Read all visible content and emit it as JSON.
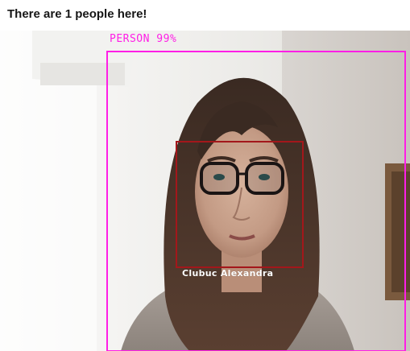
{
  "page": {
    "heading": "There are 1 people here!"
  },
  "detection": {
    "person_label": "PERSON 99%",
    "person_confidence": 99,
    "face_name": "Clubuc Alexandra"
  },
  "colors": {
    "person_box": "#ff1ee6",
    "face_box": "#a3171b",
    "name_text": "#ffffff"
  }
}
